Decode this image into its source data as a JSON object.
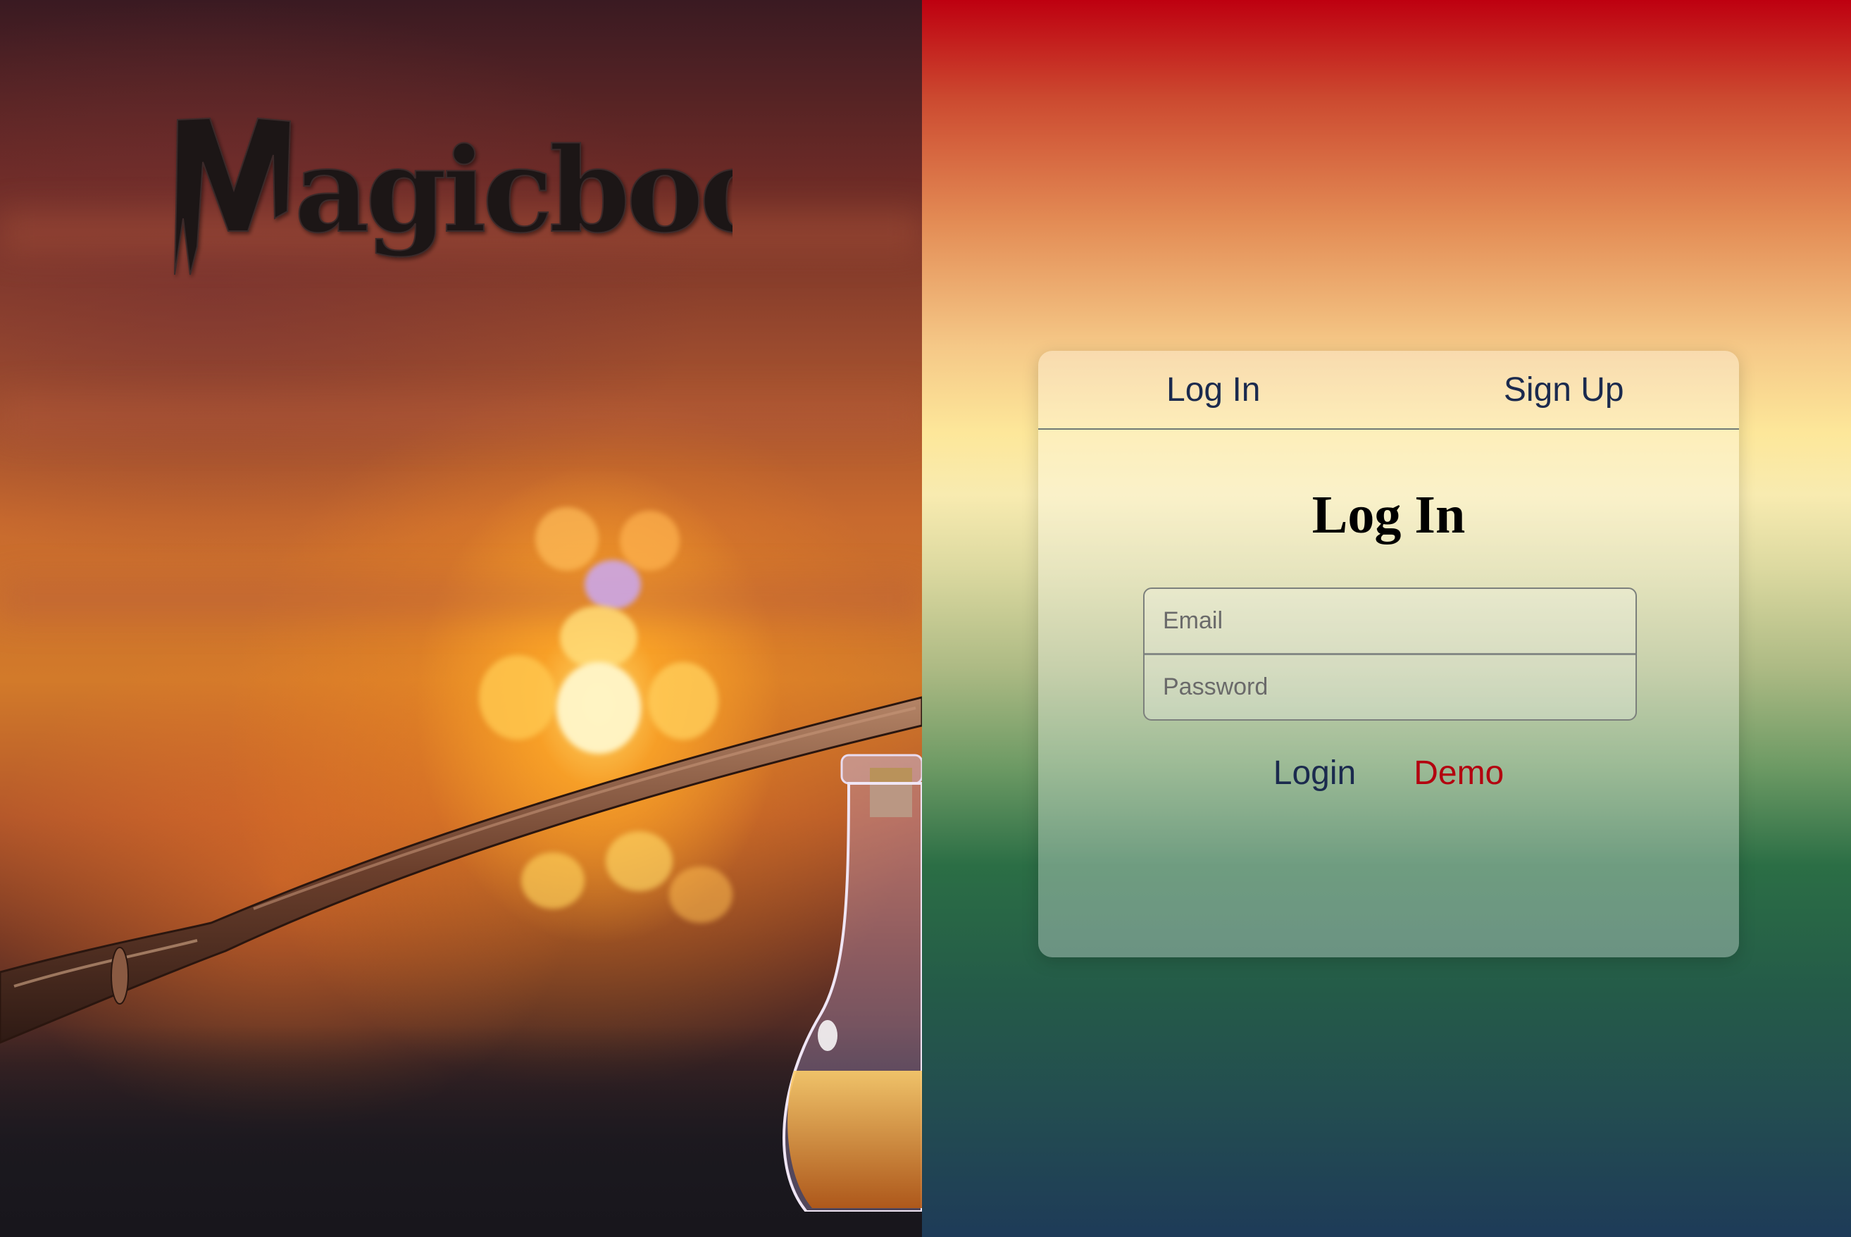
{
  "brand": {
    "logo_text": "Magicbook"
  },
  "auth_card": {
    "tabs": [
      {
        "label": "Log In",
        "active": true
      },
      {
        "label": "Sign Up",
        "active": false
      }
    ],
    "form_title": "Log In",
    "email_placeholder": "Email",
    "email_value": "",
    "password_placeholder": "Password",
    "password_value": "",
    "login_label": "Login",
    "demo_label": "Demo"
  },
  "colors": {
    "link_primary": "#1b2a4e",
    "link_demo": "#b3000f",
    "gradient_top": "#be0010",
    "gradient_bottom": "#1e3b58"
  },
  "icons": {
    "background_image": "wand-and-potion-bottle-photo"
  }
}
